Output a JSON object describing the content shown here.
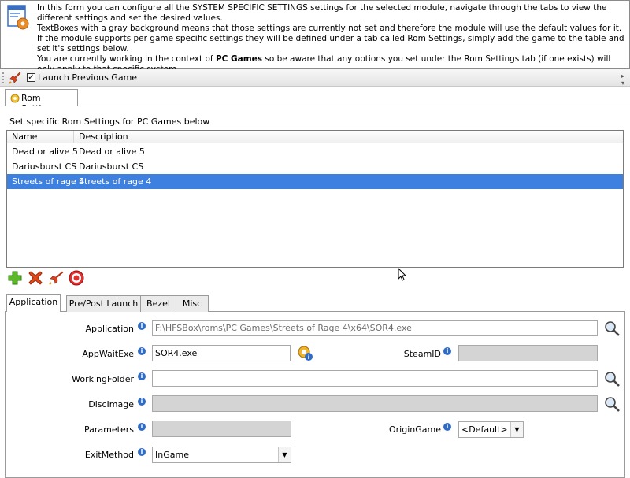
{
  "info": {
    "line1": "In this form you can configure all the SYSTEM SPECIFIC SETTINGS settings for the selected module, navigate through the tabs to view the different settings and set the desired values.",
    "line2": "TextBoxes with a gray background means that those settings are currently not set and therefore the module will use the default values for it.",
    "line3": "If the module supports per game specific settings they will be defined under a tab called Rom Settings, simply add the game to the table and set it's settings below.",
    "line4_pre": "You are currently working in the context of ",
    "line4_bold": "PC Games",
    "line4_post": " so be aware that any options you set under the Rom Settings tab (if one exists) will only apply to that specific system."
  },
  "toolbar": {
    "launch_previous_label": "Launch Previous Game",
    "launch_previous_checked": true
  },
  "top_tab": {
    "label": "Rom Settings"
  },
  "section_label": "Set specific Rom Settings for PC Games below",
  "grid": {
    "columns": [
      "Name",
      "Description"
    ],
    "rows": [
      {
        "name": "Dead or alive 5",
        "description": "Dead or alive 5",
        "selected": false
      },
      {
        "name": "Dariusburst CS",
        "description": "Dariusburst CS",
        "selected": false
      },
      {
        "name": "Streets of rage 4",
        "description": "Streets of rage 4",
        "selected": true
      }
    ]
  },
  "actions": [
    "add-icon",
    "delete-icon",
    "launch-icon",
    "target-icon"
  ],
  "lower_tabs": [
    "Application",
    "Pre/Post Launch",
    "Bezel",
    "Misc"
  ],
  "form": {
    "application": {
      "label": "Application",
      "value": "F:\\HFSBox\\roms\\PC Games\\Streets of Rage 4\\x64\\SOR4.exe"
    },
    "appwaitexe": {
      "label": "AppWaitExe",
      "value": "SOR4.exe"
    },
    "steamid": {
      "label": "SteamID",
      "value": ""
    },
    "workingfolder": {
      "label": "WorkingFolder",
      "value": ""
    },
    "discimage": {
      "label": "DiscImage",
      "value": ""
    },
    "parameters": {
      "label": "Parameters",
      "value": ""
    },
    "origingame": {
      "label": "OriginGame",
      "value": "<Default>"
    },
    "exitmethod": {
      "label": "ExitMethod",
      "value": "InGame"
    }
  },
  "colors": {
    "selection": "#3d80df",
    "info_icon": "#2f6cc8"
  }
}
